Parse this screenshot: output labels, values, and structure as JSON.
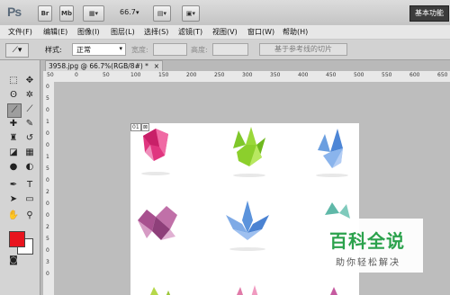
{
  "app": {
    "logo": "Ps",
    "mode_br": "Br",
    "mode_mb": "Mb",
    "zoom": "66.7",
    "workspace": "基本功能"
  },
  "menu": [
    "文件(F)",
    "编辑(E)",
    "图像(I)",
    "图层(L)",
    "选择(S)",
    "滤镜(T)",
    "视图(V)",
    "窗口(W)",
    "帮助(H)"
  ],
  "options": {
    "style_label": "样式:",
    "style_value": "正常",
    "width_label": "宽度:",
    "height_label": "高度:",
    "slice_button": "基于参考线的切片"
  },
  "document": {
    "tab": "3958.jpg @ 66.7%(RGB/8#) *",
    "slice_labels": [
      "01",
      "⊠"
    ]
  },
  "rulers": {
    "h": [
      "50",
      "0",
      "50",
      "100",
      "150",
      "200",
      "250",
      "300",
      "350",
      "400",
      "450",
      "500",
      "550",
      "600",
      "650"
    ],
    "v": [
      "0",
      "5",
      "0",
      "1",
      "0",
      "0",
      "1",
      "5",
      "0",
      "2",
      "0",
      "0",
      "2",
      "5",
      "0",
      "3",
      "0"
    ]
  },
  "watermark": {
    "title": "百科全说",
    "subtitle": "助你轻松解决"
  },
  "colors": {
    "foreground": "#e8141e",
    "background": "#ffffff"
  }
}
